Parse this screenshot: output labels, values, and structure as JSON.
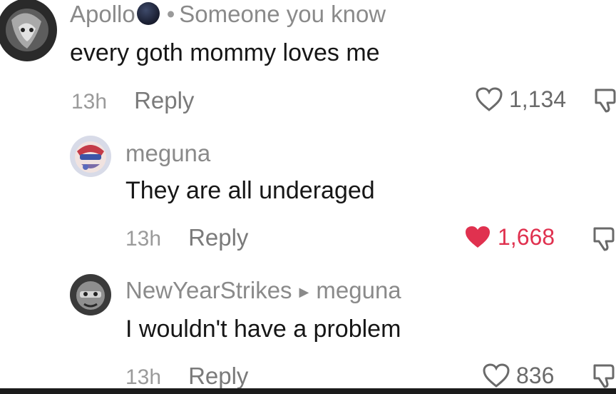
{
  "comments": [
    {
      "username": "Apollo",
      "badge": "Someone you know",
      "text": "every goth mommy loves me",
      "time": "13h",
      "reply_label": "Reply",
      "likes": "1,134",
      "liked": false
    },
    {
      "username": "meguna",
      "text": "They are all underaged",
      "time": "13h",
      "reply_label": "Reply",
      "likes": "1,668",
      "liked": true
    },
    {
      "username": "NewYearStrikes",
      "reply_to": "meguna",
      "text": "I wouldn't have a problem",
      "time": "13h",
      "reply_label": "Reply",
      "likes": "836",
      "liked": false
    }
  ],
  "colors": {
    "liked_heart": "#e0314f",
    "muted_text": "#8a8a8a",
    "body_text": "#161616"
  },
  "icons": {
    "like": "heart-icon",
    "dislike": "thumbs-down-icon",
    "reply_arrow": "triangle-right-icon",
    "name_emoji": "moon-icon"
  }
}
